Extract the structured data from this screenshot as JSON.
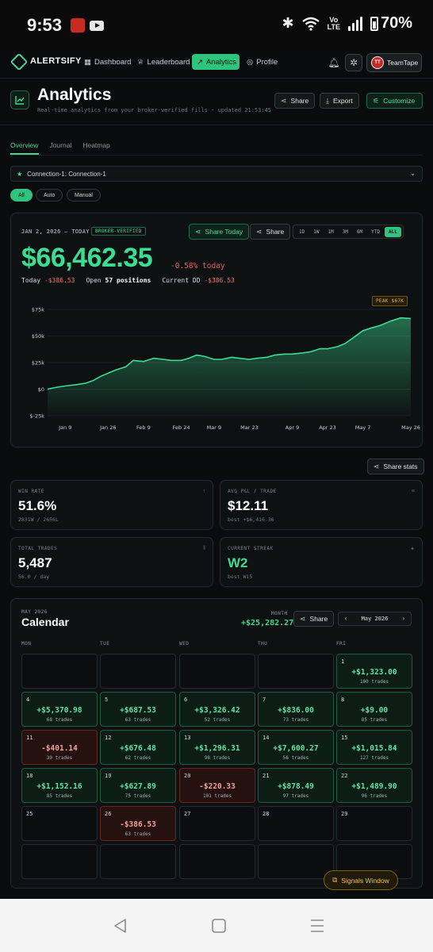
{
  "status_bar": {
    "time": "9:53",
    "battery": "70%",
    "volte_top": "Vo",
    "volte_bottom": "LTE",
    "icons": [
      "news-app-icon",
      "youtube-icon",
      "bluetooth-icon",
      "wifi-icon",
      "volte-icon",
      "signal-icon",
      "battery-icon"
    ]
  },
  "nav": {
    "brand": "ALERTSIFY",
    "items": [
      {
        "label": "Dashboard",
        "icon": "grid-icon",
        "active": false
      },
      {
        "label": "Leaderboard",
        "icon": "trophy-icon",
        "active": false
      },
      {
        "label": "Analytics",
        "icon": "trend-icon",
        "active": true
      },
      {
        "label": "Profile",
        "icon": "user-icon",
        "active": false
      }
    ],
    "user_initials": "TT",
    "user_name": "TeamTape"
  },
  "header": {
    "title": "Analytics",
    "subtitle": "Real-time analytics from your broker-verified fills · updated 21:53:45",
    "share_label": "Share",
    "export_label": "Export",
    "customize_label": "Customize"
  },
  "tabs": [
    "Overview",
    "Journal",
    "Heatmap"
  ],
  "connection": {
    "label": "Connection-1: Connection-1"
  },
  "filters": [
    "All",
    "Auto",
    "Manual"
  ],
  "equity": {
    "date_range": "JAN 2, 2026 — TODAY",
    "badge": "BROKER-VERIFIED",
    "value": "$66,462.35",
    "pct_today": "-0.58% today",
    "today_label": "Today",
    "today_value": "-$386.53",
    "open_label": "Open",
    "open_value": "57 positions",
    "dd_label": "Current DD",
    "dd_value": "-$386.53",
    "share_today_label": "Share Today",
    "share_label": "Share",
    "ranges": [
      "1D",
      "1W",
      "1M",
      "3M",
      "6M",
      "YTD",
      "ALL"
    ],
    "active_range": "ALL",
    "peak_label": "PEAK $67K"
  },
  "chart_data": {
    "type": "area",
    "title": "",
    "xlabel": "",
    "ylabel": "",
    "x_ticks": [
      "Jan 9",
      "Jan 26",
      "Feb 9",
      "Feb 24",
      "Mar 9",
      "Mar 23",
      "Apr 9",
      "Apr 23",
      "May 7",
      "May 26"
    ],
    "y_ticks": [
      "$75k",
      "$50k",
      "$25k",
      "$0",
      "$-25k"
    ],
    "ylim": [
      -25000,
      75000
    ],
    "grid": true,
    "series": [
      {
        "points": [
          [
            "Jan 2",
            0
          ],
          [
            "Jan 5",
            1500
          ],
          [
            "Jan 9",
            3000
          ],
          [
            "Jan 13",
            4000
          ],
          [
            "Jan 17",
            5500
          ],
          [
            "Jan 20",
            8000
          ],
          [
            "Jan 23",
            12000
          ],
          [
            "Jan 26",
            15000
          ],
          [
            "Jan 29",
            18000
          ],
          [
            "Feb 2",
            21000
          ],
          [
            "Feb 5",
            27000
          ],
          [
            "Feb 9",
            26000
          ],
          [
            "Feb 13",
            29000
          ],
          [
            "Feb 17",
            28000
          ],
          [
            "Feb 20",
            27000
          ],
          [
            "Feb 24",
            27000
          ],
          [
            "Feb 27",
            29000
          ],
          [
            "Mar 2",
            32000
          ],
          [
            "Mar 5",
            31000
          ],
          [
            "Mar 9",
            28000
          ],
          [
            "Mar 12",
            28000
          ],
          [
            "Mar 16",
            30000
          ],
          [
            "Mar 19",
            29000
          ],
          [
            "Mar 23",
            28000
          ],
          [
            "Mar 26",
            29000
          ],
          [
            "Mar 30",
            30000
          ],
          [
            "Apr 2",
            32000
          ],
          [
            "Apr 6",
            33000
          ],
          [
            "Apr 9",
            33000
          ],
          [
            "Apr 13",
            34000
          ],
          [
            "Apr 16",
            35000
          ],
          [
            "Apr 20",
            38000
          ],
          [
            "Apr 23",
            38000
          ],
          [
            "Apr 27",
            40000
          ],
          [
            "Apr 30",
            43000
          ],
          [
            "May 3",
            48000
          ],
          [
            "May 7",
            55000
          ],
          [
            "May 11",
            58000
          ],
          [
            "May 14",
            60000
          ],
          [
            "May 18",
            64000
          ],
          [
            "May 22",
            67000
          ],
          [
            "May 26",
            66462
          ]
        ]
      }
    ],
    "line_color": "#3ddc93"
  },
  "share_stats_label": "Share stats",
  "stats": [
    {
      "label": "WIN RATE",
      "value": "51.6%",
      "sub": "2831W / 2656L",
      "icon": "↑",
      "value_color": "#ffffff"
    },
    {
      "label": "AVG P&L / TRADE",
      "value": "$12.11",
      "sub": "best +$6,416.36",
      "icon": "≡",
      "value_color": "#ffffff"
    },
    {
      "label": "TOTAL TRADES",
      "value": "5,487",
      "sub": "56.0 / day",
      "icon": "‖",
      "value_color": "#ffffff"
    },
    {
      "label": "CURRENT STREAK",
      "value": "W2",
      "sub": "best W15",
      "icon": "✦",
      "value_color": "#3ddc93"
    }
  ],
  "calendar": {
    "month_label": "MAY 2026",
    "title": "Calendar",
    "month_total_label": "MONTH",
    "month_total": "+$25,282.27",
    "share_label": "Share",
    "nav_month": "May 2026",
    "weekdays": [
      "MON",
      "TUE",
      "WED",
      "THU",
      "FRI"
    ],
    "rows": [
      [
        null,
        null,
        null,
        null,
        {
          "day": "1",
          "pnl": "+$1,323.00",
          "trades": "100 trades",
          "pos": true
        }
      ],
      [
        {
          "day": "4",
          "pnl": "+$5,370.98",
          "trades": "68 trades",
          "pos": true
        },
        {
          "day": "5",
          "pnl": "+$687.53",
          "trades": "63 trades",
          "pos": true
        },
        {
          "day": "6",
          "pnl": "+$3,326.42",
          "trades": "52 trades",
          "pos": true
        },
        {
          "day": "7",
          "pnl": "+$836.00",
          "trades": "73 trades",
          "pos": true
        },
        {
          "day": "8",
          "pnl": "+$9.00",
          "trades": "85 trades",
          "pos": true
        }
      ],
      [
        {
          "day": "11",
          "pnl": "-$401.14",
          "trades": "30 trades",
          "pos": false
        },
        {
          "day": "12",
          "pnl": "+$676.48",
          "trades": "62 trades",
          "pos": true
        },
        {
          "day": "13",
          "pnl": "+$1,296.31",
          "trades": "98 trades",
          "pos": true
        },
        {
          "day": "14",
          "pnl": "+$7,600.27",
          "trades": "56 trades",
          "pos": true
        },
        {
          "day": "15",
          "pnl": "+$1,015.84",
          "trades": "127 trades",
          "pos": true
        }
      ],
      [
        {
          "day": "18",
          "pnl": "+$1,152.16",
          "trades": "85 trades",
          "pos": true
        },
        {
          "day": "19",
          "pnl": "+$627.89",
          "trades": "75 trades",
          "pos": true
        },
        {
          "day": "20",
          "pnl": "-$220.33",
          "trades": "101 trades",
          "pos": false
        },
        {
          "day": "21",
          "pnl": "+$878.49",
          "trades": "97 trades",
          "pos": true
        },
        {
          "day": "22",
          "pnl": "+$1,489.90",
          "trades": "96 trades",
          "pos": true
        }
      ],
      [
        {
          "day": "25",
          "pnl": "",
          "trades": "",
          "pos": null
        },
        {
          "day": "26",
          "pnl": "-$386.53",
          "trades": "63 trades",
          "pos": false
        },
        {
          "day": "27",
          "pnl": "",
          "trades": "",
          "pos": null
        },
        {
          "day": "28",
          "pnl": "",
          "trades": "",
          "pos": null
        },
        {
          "day": "29",
          "pnl": "",
          "trades": "",
          "pos": null
        }
      ],
      [
        null,
        null,
        null,
        null,
        null
      ]
    ]
  },
  "signals_window_label": "Signals Window",
  "colors": {
    "accent": "#2ec47e",
    "positive": "#3ddc93",
    "negative": "#ef5a58",
    "gold": "#eab53a"
  }
}
